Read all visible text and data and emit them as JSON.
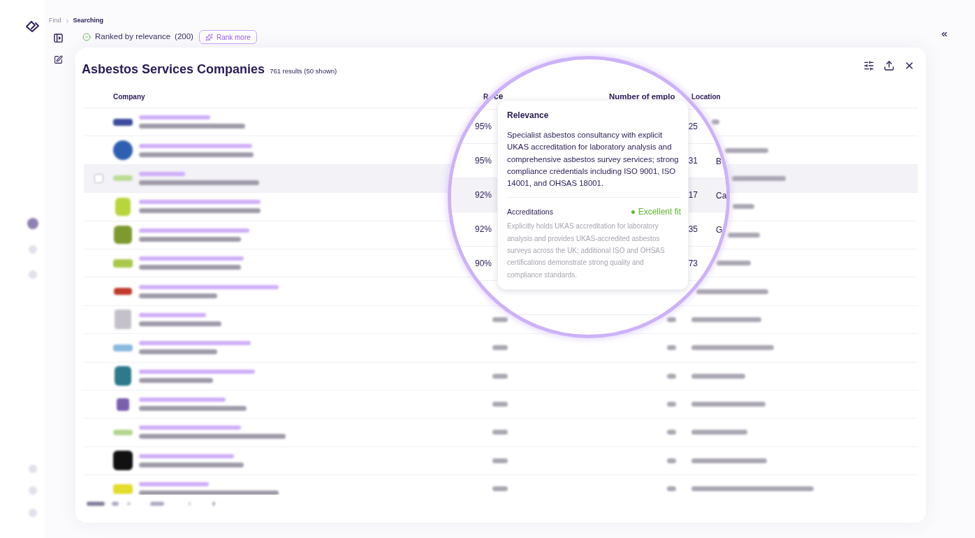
{
  "breadcrumb": [
    {
      "label": "Find",
      "current": false
    },
    {
      "label": "Searching",
      "current": true
    }
  ],
  "ranking": {
    "label": "Ranked by relevance",
    "count": "(200)"
  },
  "rank_more_button": {
    "label": "Rank more"
  },
  "results": {
    "title": "Asbestos Services Companies",
    "summary": "761 results (50 shown)"
  },
  "table": {
    "columns": [
      "Company",
      "R",
      "Location"
    ],
    "rows": [
      {
        "hovered": false
      },
      {
        "hovered": false
      },
      {
        "hovered": true
      },
      {
        "hovered": false
      },
      {
        "hovered": false
      },
      {
        "hovered": false
      },
      {
        "hovered": false
      },
      {
        "hovered": false
      },
      {
        "hovered": false
      },
      {
        "hovered": false
      },
      {
        "hovered": false
      },
      {
        "hovered": false
      },
      {
        "hovered": false
      },
      {
        "hovered": false
      }
    ]
  },
  "magnifier": {
    "columns": [
      "ce",
      "Number of emplo"
    ],
    "rows": [
      {
        "relevance": "95%",
        "employees": "25",
        "hovered": false
      },
      {
        "relevance": "95%",
        "employees": "31",
        "location": "B",
        "hovered": false
      },
      {
        "relevance": "92%",
        "employees": "17",
        "location": "Ca",
        "hovered": true
      },
      {
        "relevance": "92%",
        "employees": "35",
        "location": "G",
        "hovered": false
      },
      {
        "relevance": "90%",
        "employees": "73",
        "hovered": false
      }
    ],
    "tooltip": {
      "title": "Relevance",
      "summary": "Specialist asbestos consultancy with explicit UKAS accreditation for laboratory analysis and comprehensive asbestos survey services; strong compliance credentials including ISO 9001, ISO 14001, and OHSAS 18001.",
      "criteria": [
        {
          "name": "Accreditations",
          "fit": "Excellent fit",
          "color": "#5cb82e",
          "explanation": "Explicitly holds UKAS accreditation for laboratory analysis and provides UKAS-accredited asbestos surveys across the UK; additional ISO and OHSAS certifications demonstrate strong quality and compliance standards."
        }
      ]
    }
  }
}
